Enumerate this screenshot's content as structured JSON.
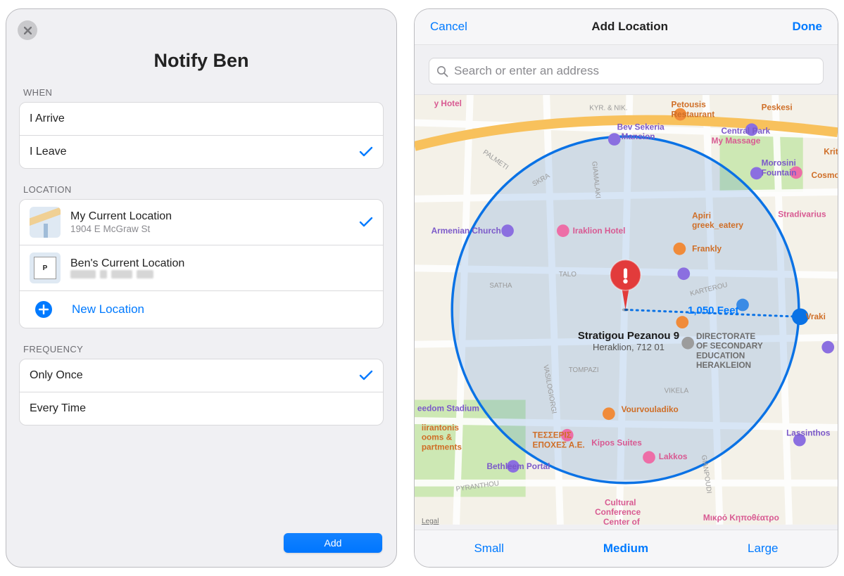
{
  "left": {
    "title": "Notify Ben",
    "sections": {
      "when": {
        "header": "WHEN",
        "options": [
          {
            "label": "I Arrive",
            "selected": false
          },
          {
            "label": "I Leave",
            "selected": true
          }
        ]
      },
      "location": {
        "header": "LOCATION",
        "items": [
          {
            "title": "My Current Location",
            "subtitle": "1904 E McGraw St",
            "selected": true
          },
          {
            "title": "Ben's Current Location",
            "subtitle_hidden": true,
            "selected": false
          }
        ],
        "new_label": "New Location"
      },
      "frequency": {
        "header": "FREQUENCY",
        "options": [
          {
            "label": "Only Once",
            "selected": true
          },
          {
            "label": "Every Time",
            "selected": false
          }
        ]
      }
    },
    "add_button": "Add"
  },
  "right": {
    "nav": {
      "cancel": "Cancel",
      "title": "Add Location",
      "done": "Done"
    },
    "search_placeholder": "Search or enter an address",
    "radius_label": "1,050 Feet",
    "pin": {
      "address": "Stratigou Pezanou 9",
      "city": "Heraklion, 712 01"
    },
    "legal": "Legal",
    "sizes": {
      "small": "Small",
      "medium": "Medium",
      "large": "Large"
    }
  },
  "map_poi": {
    "hotels": [
      "Iraklion Hotel",
      "Kipos Suites",
      "My Massage",
      "Lakkos"
    ],
    "food": [
      "Apiri greek_eatery",
      "Frankly",
      "Vourvouladiko",
      "ΤΕΣΣΕΡΙΣ ΕΠΟΧΕΣ Α.Ε.",
      "Petousis Restaurant",
      "Peskesi",
      "Kritiko",
      "Cosmos"
    ],
    "landmarks": [
      "Armenian Church",
      "Bev Sekeria Mansion",
      "Morosini Fountain",
      "Central Park",
      "Bethleem Portal",
      "DIRECTORATE OF SECONDARY EDUCATION HERAKLEION",
      "Lassinthos",
      "Stradivarius",
      "Cultural Conference Center of Heraklion",
      "Μικρό Κηποθέατρο Ηρακλείου",
      "eedom Stadium",
      "iirantonis ooms & partments",
      "y Hotel",
      "Vraki"
    ],
    "streets": [
      "SKRA",
      "PALMETI",
      "SATHA",
      "TALO",
      "GIAMALAKI",
      "KYR. & NIK.",
      "VASILOGIORGI",
      "TOMPAZI",
      "KARTEROU",
      "VIKELA",
      "GIANPOUDI",
      "PYRANTHOU"
    ]
  }
}
